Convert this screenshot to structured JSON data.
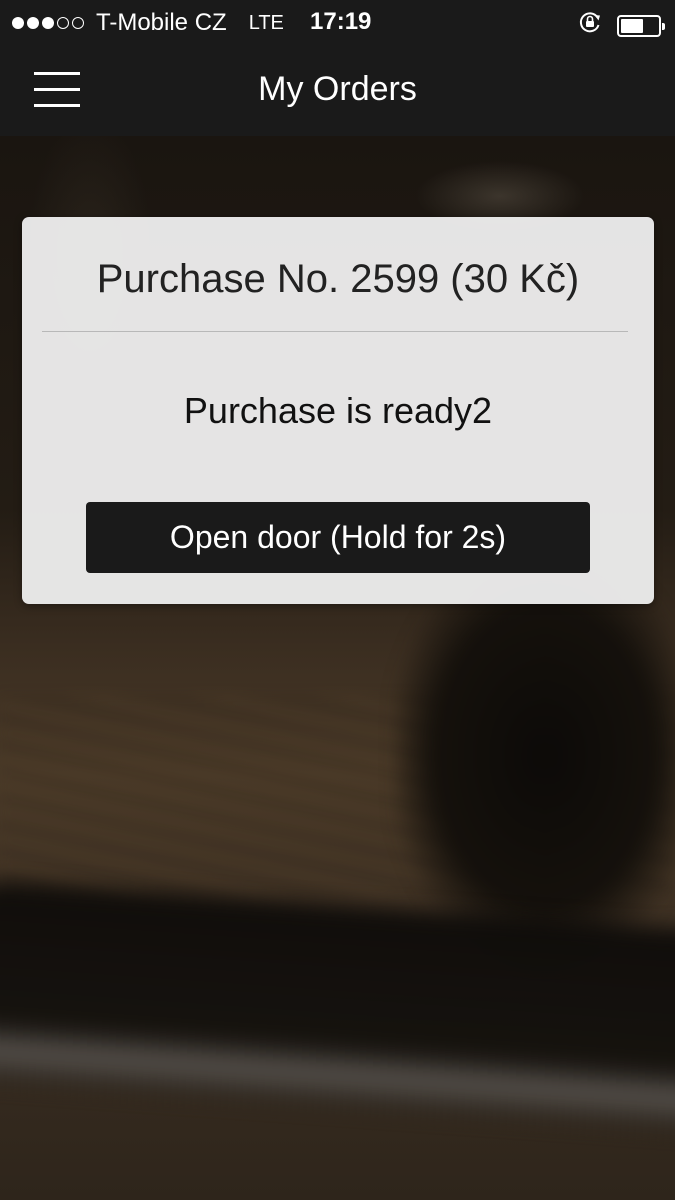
{
  "status_bar": {
    "signal_bars_filled": 3,
    "signal_bars_total": 5,
    "carrier": "T-Mobile CZ",
    "network": "LTE",
    "time": "17:19",
    "icons": [
      "rotation-lock-icon",
      "battery-icon"
    ],
    "battery_level": 0.62
  },
  "nav": {
    "menu_icon": "hamburger-menu-icon",
    "title": "My Orders"
  },
  "order": {
    "title": "Purchase No. 2599 (30 Kč)",
    "status": "Purchase is ready2",
    "action_label": "Open door (Hold for 2s)"
  },
  "colors": {
    "bar_background": "#1a1a1a",
    "card_background": "#ebebeb",
    "button_background": "#1a1a1a",
    "text_light": "#ffffff",
    "text_dark": "#222222"
  }
}
